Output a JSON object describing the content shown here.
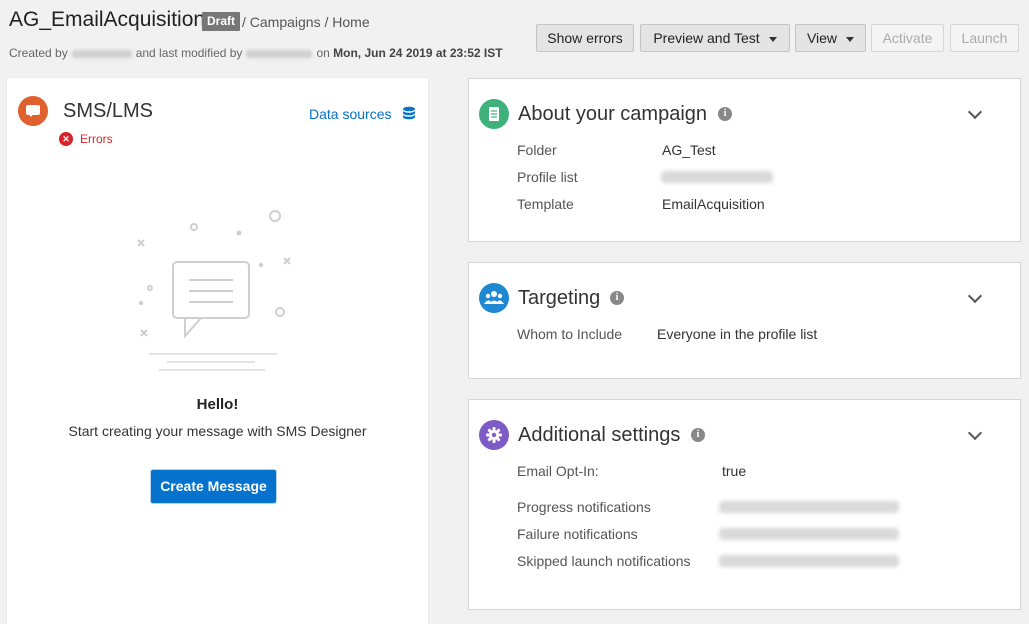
{
  "header": {
    "title": "AG_EmailAcquisition",
    "status_badge": "Draft",
    "breadcrumb": "/ Campaigns / Home",
    "meta_created_prefix": "Created by",
    "meta_modified_mid": "and last modified by",
    "meta_on": "on",
    "meta_date": "Mon, Jun 24 2019 at 23:52 IST"
  },
  "toolbar": {
    "show_errors": "Show errors",
    "preview_test": "Preview and Test",
    "view": "View",
    "activate": "Activate",
    "launch": "Launch"
  },
  "channel_panel": {
    "channel_name": "SMS/LMS",
    "error_label": "Errors",
    "data_sources": "Data sources",
    "hello": "Hello!",
    "subtitle": "Start creating your message with SMS Designer",
    "create_button": "Create Message"
  },
  "about": {
    "title": "About your campaign",
    "rows": [
      {
        "label": "Folder",
        "value": "AG_Test"
      },
      {
        "label": "Profile list",
        "value": ""
      },
      {
        "label": "Template",
        "value": "EmailAcquisition"
      }
    ]
  },
  "targeting": {
    "title": "Targeting",
    "rows": [
      {
        "label": "Whom to Include",
        "value": "Everyone in the profile list"
      }
    ]
  },
  "additional": {
    "title": "Additional settings",
    "rows": [
      {
        "label": "Email Opt-In:",
        "value": "true"
      },
      {
        "label": "Progress notifications",
        "value": ""
      },
      {
        "label": "Failure notifications",
        "value": ""
      },
      {
        "label": "Skipped launch notifications",
        "value": ""
      }
    ]
  },
  "colors": {
    "accent_blue": "#0572ce",
    "channel_orange": "#e0612d",
    "about_green": "#3fb27b",
    "targeting_blue": "#1e88d2",
    "settings_purple": "#7e5bc4",
    "error_red": "#d8232a"
  },
  "icons": {
    "channel": "sms-chat-icon",
    "error": "error-x-icon",
    "datasources": "database-icon",
    "about": "document-icon",
    "targeting": "people-icon",
    "settings": "gear-icon",
    "info": "info-icon",
    "collapse": "chevron-down-icon"
  }
}
